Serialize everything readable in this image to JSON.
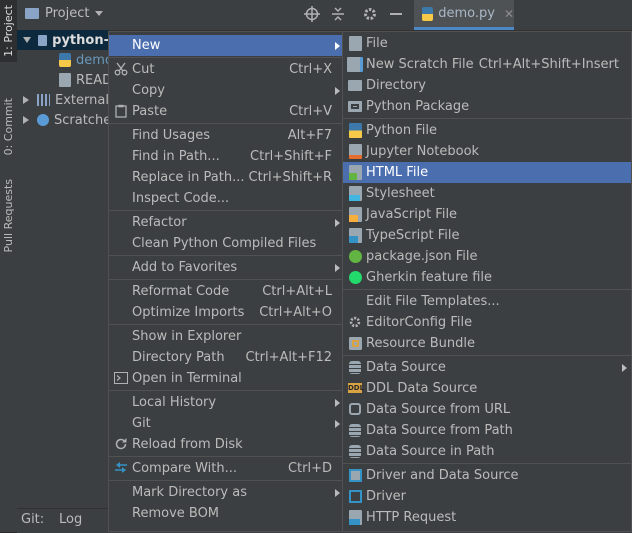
{
  "tool_window_tabs": [
    {
      "label": "1: Project"
    },
    {
      "label": "0: Commit"
    },
    {
      "label": "Pull Requests"
    }
  ],
  "toolbar": {
    "project_label": "Project",
    "editor_tab": "demo.py"
  },
  "tree": {
    "root": "python-",
    "child_file1": "demo",
    "child_file2": "READ",
    "external": "External",
    "scratches": "Scratche"
  },
  "bottom_bar": {
    "git_label": "Git:",
    "log_tab": "Log"
  },
  "context_menu": [
    {
      "label": "New",
      "shortcut": "",
      "submenu": true
    },
    {
      "label": "Cut",
      "shortcut": "Ctrl+X"
    },
    {
      "label": "Copy",
      "shortcut": "",
      "submenu": true
    },
    {
      "label": "Paste",
      "shortcut": "Ctrl+V"
    },
    {
      "label": "Find Usages",
      "shortcut": "Alt+F7"
    },
    {
      "label": "Find in Path...",
      "shortcut": "Ctrl+Shift+F"
    },
    {
      "label": "Replace in Path...",
      "shortcut": "Ctrl+Shift+R"
    },
    {
      "label": "Inspect Code...",
      "shortcut": ""
    },
    {
      "label": "Refactor",
      "shortcut": "",
      "submenu": true
    },
    {
      "label": "Clean Python Compiled Files",
      "shortcut": ""
    },
    {
      "label": "Add to Favorites",
      "shortcut": "",
      "submenu": true
    },
    {
      "label": "Reformat Code",
      "shortcut": "Ctrl+Alt+L"
    },
    {
      "label": "Optimize Imports",
      "shortcut": "Ctrl+Alt+O"
    },
    {
      "label": "Show in Explorer",
      "shortcut": ""
    },
    {
      "label": "Directory Path",
      "shortcut": "Ctrl+Alt+F12"
    },
    {
      "label": "Open in Terminal",
      "shortcut": ""
    },
    {
      "label": "Local History",
      "shortcut": "",
      "submenu": true
    },
    {
      "label": "Git",
      "shortcut": "",
      "submenu": true
    },
    {
      "label": "Reload from Disk",
      "shortcut": ""
    },
    {
      "label": "Compare With...",
      "shortcut": "Ctrl+D"
    },
    {
      "label": "Mark Directory as",
      "shortcut": "",
      "submenu": true
    },
    {
      "label": "Remove BOM",
      "shortcut": ""
    }
  ],
  "new_submenu": [
    {
      "label": "File",
      "shortcut": "",
      "icon": "file-icon"
    },
    {
      "label": "New Scratch File",
      "shortcut": "Ctrl+Alt+Shift+Insert",
      "icon": "scratch-file-icon"
    },
    {
      "label": "Directory",
      "shortcut": "",
      "icon": "folder-icon"
    },
    {
      "label": "Python Package",
      "shortcut": "",
      "icon": "package-folder-icon"
    },
    {
      "label": "Python File",
      "shortcut": "",
      "icon": "python-file-icon"
    },
    {
      "label": "Jupyter Notebook",
      "shortcut": "",
      "icon": "jupyter-icon"
    },
    {
      "label": "HTML File",
      "shortcut": "",
      "icon": "html-file-icon"
    },
    {
      "label": "Stylesheet",
      "shortcut": "",
      "icon": "css-file-icon"
    },
    {
      "label": "JavaScript File",
      "shortcut": "",
      "icon": "js-file-icon"
    },
    {
      "label": "TypeScript File",
      "shortcut": "",
      "icon": "ts-file-icon"
    },
    {
      "label": "package.json File",
      "shortcut": "",
      "icon": "npm-icon"
    },
    {
      "label": "Gherkin feature file",
      "shortcut": "",
      "icon": "gherkin-icon"
    },
    {
      "label": "Edit File Templates...",
      "shortcut": "",
      "icon": ""
    },
    {
      "label": "EditorConfig File",
      "shortcut": "",
      "icon": "gear-icon"
    },
    {
      "label": "Resource Bundle",
      "shortcut": "",
      "icon": "resource-bundle-icon"
    },
    {
      "label": "Data Source",
      "shortcut": "",
      "icon": "database-icon",
      "submenu": true
    },
    {
      "label": "DDL Data Source",
      "shortcut": "",
      "icon": "ddl-icon"
    },
    {
      "label": "Data Source from URL",
      "shortcut": "",
      "icon": "url-icon"
    },
    {
      "label": "Data Source from Path",
      "shortcut": "",
      "icon": "database-icon"
    },
    {
      "label": "Data Source in Path",
      "shortcut": "",
      "icon": "database-icon"
    },
    {
      "label": "Driver and Data Source",
      "shortcut": "",
      "icon": "driver-icon"
    },
    {
      "label": "Driver",
      "shortcut": "",
      "icon": "driver-icon"
    },
    {
      "label": "HTTP Request",
      "shortcut": "",
      "icon": "api-icon"
    }
  ],
  "colors": {
    "background": "#2b2b2b",
    "panel": "#3c3f41",
    "selection": "#4b6eaf",
    "separator": "#515151",
    "text": "#bbbbbb"
  }
}
